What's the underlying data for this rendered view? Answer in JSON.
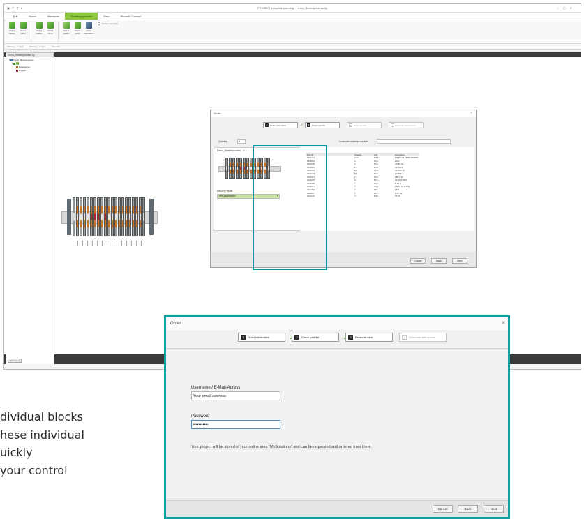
{
  "app": {
    "window_title": "PROJECT complete planning - Demo_Bestellprozess/dy",
    "tabs": [
      "Home",
      "Interfaces",
      "Ordering process",
      "View",
      "Phoenix Contact"
    ],
    "active_tab": "Ordering process",
    "ribbon_buttons": [
      {
        "label": "Add to basket",
        "icon": "add-to-basket-icon"
      },
      {
        "label": "Check parts",
        "icon": "check-icon"
      },
      {
        "label": "Add to basket",
        "icon": "add-to-basket-icon"
      },
      {
        "label": "Check parts",
        "icon": "check-icon"
      },
      {
        "label": "Add to basket",
        "icon": "cart-icon"
      },
      {
        "label": "Check parts",
        "icon": "check-icon"
      },
      {
        "label": "Price Calculation",
        "icon": "calculator-icon"
      }
    ],
    "ribbon_extra": "Delivery template",
    "ribbon_groups": [
      "Software - 3 days",
      "Partners - 3 days",
      "Standard"
    ],
    "panel_tab": "Demo_Bestellprozess.dy",
    "tree": [
      {
        "label": "Demo_Bestellprozess",
        "level": 1
      },
      {
        "label": "X1",
        "level": 2,
        "highlight": true
      },
      {
        "label": "Accessories",
        "level": 3
      },
      {
        "label": "Bridges",
        "level": 3
      }
    ],
    "status_button": "Messages",
    "colors": {
      "accent_green": "#8cc63f",
      "teal_frame": "#009a9a",
      "orange_block": "#c9782b",
      "red_block": "#a9282b"
    }
  },
  "dialog_small": {
    "title": "Order",
    "close": "×",
    "steps": [
      {
        "num": "1",
        "label": "Order information",
        "state": "done"
      },
      {
        "num": "2",
        "label": "Check part list",
        "state": "current"
      },
      {
        "num": "3",
        "label": "Personal data",
        "state": "inactive"
      },
      {
        "num": "4",
        "label": "Summary and upload",
        "state": "inactive"
      }
    ],
    "quantity_label": "Quantity",
    "quantity_value": "1",
    "customer_ref_label": "Customer material number",
    "config_title": "Demo_Bestellprozess - X 1",
    "delivery_label": "Delivery mode",
    "delivery_value": "Pre-assembled",
    "table_headers": [
      "Part ID",
      "Quantity",
      "Unit",
      "Description"
    ],
    "table_rows": [
      [
        "0401774",
        "0.77",
        "MTR",
        "NS 35/ 7,5 PERF 2000MM"
      ],
      [
        "3013509",
        "1",
        "PCE",
        "ECS 2"
      ],
      [
        "3010093",
        "2",
        "PCE",
        "UK 5N-CL"
      ],
      [
        "3014305",
        "1",
        "PCE",
        "UK 5N-G"
      ],
      [
        "3018124",
        "14",
        "PCE",
        "UK 5HF 10"
      ],
      [
        "3018149",
        "16",
        "PCE",
        "UK 5HF 4"
      ],
      [
        "3030447",
        "2",
        "PCE",
        "FBS 2-10"
      ],
      [
        "3032278",
        "2",
        "PCE",
        "CLIPFIX 35-5"
      ],
      [
        "3030420",
        "7",
        "PCE",
        "D-ST 4"
      ],
      [
        "3030473",
        "7",
        "PCE",
        "RB ST 10 (2.5/4)"
      ],
      [
        "3211757",
        "7",
        "PCE",
        "PT 4"
      ],
      [
        "3210037",
        "7",
        "PCE",
        "D-PT 10"
      ],
      [
        "3212120",
        "7",
        "PCE",
        "PT 10"
      ]
    ],
    "buttons": {
      "cancel": "Cancel",
      "back": "Back",
      "next": "Next"
    }
  },
  "dialog_large": {
    "title": "Order",
    "close": "×",
    "steps": [
      {
        "num": "1",
        "label": "Order information",
        "state": "done"
      },
      {
        "num": "2",
        "label": "Check part list",
        "state": "done"
      },
      {
        "num": "3",
        "label": "Personal data",
        "state": "current"
      },
      {
        "num": "4",
        "label": "Summary and upload",
        "state": "inactive"
      }
    ],
    "username_label": "Username / E-Mail-Adress",
    "username_value": "Your email address",
    "password_label": "Password",
    "password_value": "•••••••••••",
    "info_text": "Your project will be stored in your online area \"MySolutions\" and can be requested and ordered from there.",
    "buttons": {
      "cancel": "Cancel",
      "back": "Back",
      "next": "Next"
    }
  },
  "slide_text": {
    "line1": "dividual blocks",
    "line2": "hese individual",
    "line3": "uickly",
    "line4": "your control"
  }
}
